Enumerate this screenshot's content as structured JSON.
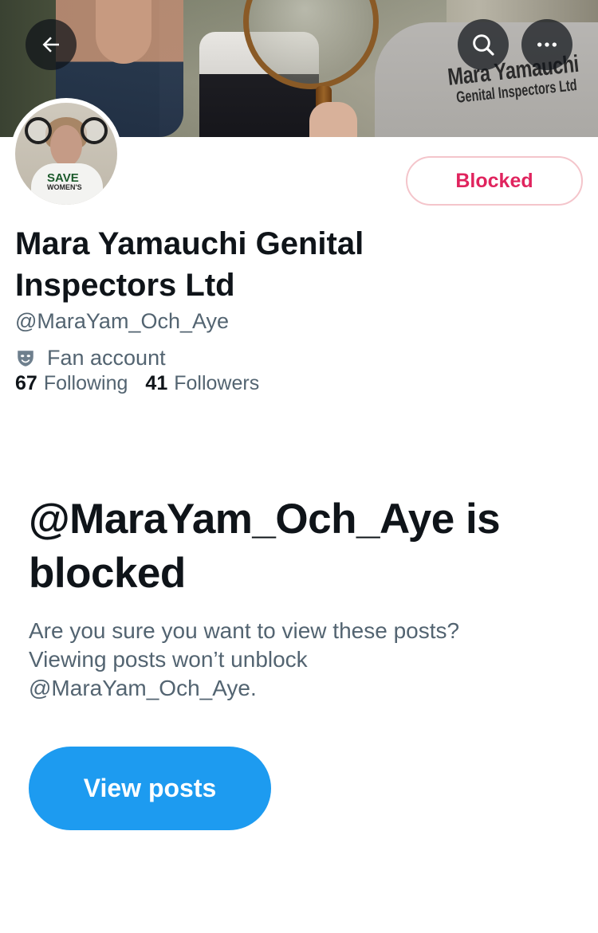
{
  "header": {
    "back_icon": "arrow-left-icon",
    "search_icon": "search-icon",
    "more_icon": "more-horizontal-icon",
    "banner_shirt_text_line1": "Mara Yamauchi",
    "banner_shirt_text_line2": "Genital Inspectors Ltd"
  },
  "profile": {
    "display_name": "Mara Yamauchi Genital Inspectors Ltd",
    "handle": "@MaraYam_Och_Aye",
    "category_icon": "theater-mask-icon",
    "category": "Fan account",
    "following_count": "67",
    "following_label": "Following",
    "followers_count": "41",
    "followers_label": "Followers",
    "relationship_button_label": "Blocked",
    "avatar_shirt_text_line1": "SAVE",
    "avatar_shirt_text_line2": "WOMEN'S"
  },
  "blocked_notice": {
    "title": "@MaraYam_Och_Aye is blocked",
    "description": "Are you sure you want to view these posts? Viewing posts won’t unblock @MaraYam_Och_Aye.",
    "view_posts_label": "View posts"
  },
  "colors": {
    "accent_blue": "#1d9bf0",
    "blocked_red": "#e0245e",
    "secondary_text": "#536471",
    "primary_text": "#0f1419"
  }
}
